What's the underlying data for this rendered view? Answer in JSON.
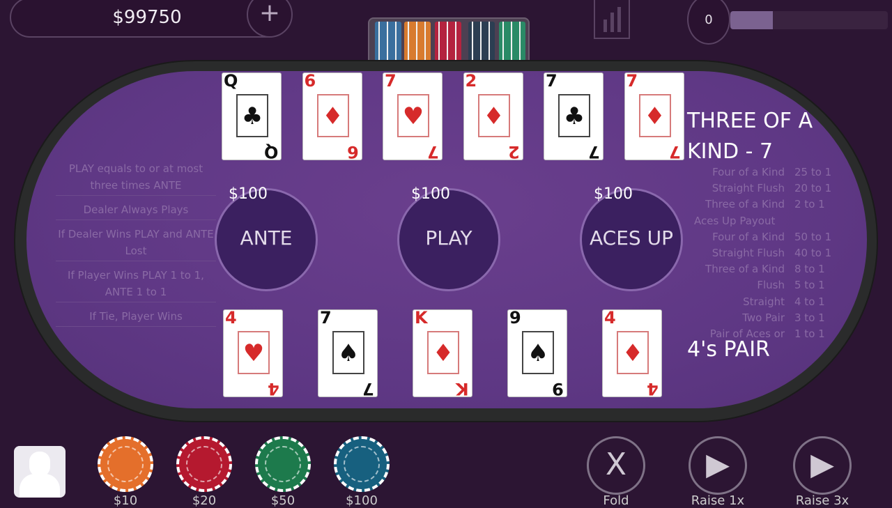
{
  "balance": "$99750",
  "add_button": "+",
  "level": {
    "value": "0",
    "progress": 0.27
  },
  "shoe_chip_colors": [
    "#3a6f9e",
    "#d87b2f",
    "#b4233f",
    "#2c3e52",
    "#2a8a66"
  ],
  "rules_left": [
    "PLAY equals to or at most three times ANTE",
    "Dealer Always Plays",
    "If Dealer Wins PLAY and ANTE Lost",
    "If Player Wins PLAY 1 to 1, ANTE 1 to 1",
    "If Tie, Player Wins"
  ],
  "payout_right": [
    {
      "name": "Four of a Kind",
      "value": "25 to 1"
    },
    {
      "name": "Straight Flush",
      "value": "20 to 1"
    },
    {
      "name": "Three of a Kind",
      "value": "2 to 1"
    },
    {
      "name": "Aces Up Payout",
      "value": ""
    },
    {
      "name": "Four of a Kind",
      "value": "50 to 1"
    },
    {
      "name": "Straight Flush",
      "value": "40 to 1"
    },
    {
      "name": "Three of a Kind",
      "value": "8 to 1"
    },
    {
      "name": "Flush",
      "value": "5 to 1"
    },
    {
      "name": "Straight",
      "value": "4 to 1"
    },
    {
      "name": "Two Pair",
      "value": "3 to 1"
    },
    {
      "name": "Pair of Aces or",
      "value": "1 to 1"
    }
  ],
  "dealer_cards": [
    {
      "rank": "Q",
      "suit": "♣",
      "color": "black"
    },
    {
      "rank": "6",
      "suit": "♦",
      "color": "red"
    },
    {
      "rank": "7",
      "suit": "♥",
      "color": "red"
    },
    {
      "rank": "2",
      "suit": "♦",
      "color": "red"
    },
    {
      "rank": "7",
      "suit": "♣",
      "color": "black"
    },
    {
      "rank": "7",
      "suit": "♦",
      "color": "red"
    }
  ],
  "dealer_hand": "THREE OF A KIND  - 7",
  "player_cards": [
    {
      "rank": "4",
      "suit": "♥",
      "color": "red"
    },
    {
      "rank": "7",
      "suit": "♠",
      "color": "black"
    },
    {
      "rank": "K",
      "suit": "♦",
      "color": "red"
    },
    {
      "rank": "9",
      "suit": "♠",
      "color": "black"
    },
    {
      "rank": "4",
      "suit": "♦",
      "color": "red"
    }
  ],
  "player_hand": "4's PAIR",
  "bets": [
    {
      "label": "ANTE",
      "amount": "$100"
    },
    {
      "label": "PLAY",
      "amount": "$100"
    },
    {
      "label": "ACES UP",
      "amount": "$100"
    }
  ],
  "chips": [
    {
      "color": "#e46f2b",
      "label": "$10"
    },
    {
      "color": "#b5192f",
      "label": "$20"
    },
    {
      "color": "#1d7a4c",
      "label": "$50"
    },
    {
      "color": "#17607f",
      "label": "$100"
    }
  ],
  "controls": [
    {
      "icon": "close-icon",
      "glyph": "X",
      "label": "Fold"
    },
    {
      "icon": "play-icon",
      "glyph": "▶",
      "label": "Raise 1x"
    },
    {
      "icon": "play-icon",
      "glyph": "▶",
      "label": "Raise 3x"
    }
  ]
}
